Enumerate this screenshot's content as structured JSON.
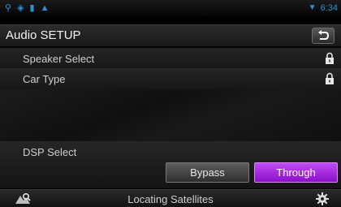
{
  "status_bar": {
    "icons": [
      "usb-icon",
      "wireless-icon",
      "battery-icon",
      "warning-icon"
    ],
    "clock": "6:34",
    "accent_color": "#2e8fd4"
  },
  "header": {
    "title": "Audio SETUP",
    "back_icon": "back-arrow-icon"
  },
  "settings": [
    {
      "label": "Speaker Select",
      "icon": "lock-icon"
    },
    {
      "label": "Car Type",
      "icon": "lock-icon"
    }
  ],
  "dsp": {
    "label": "DSP Select",
    "options": [
      "Bypass",
      "Through"
    ],
    "selected": "Through",
    "selected_color": "#a82ee0"
  },
  "footer": {
    "status": "Locating Satellites",
    "left_icon": "navigation-icon",
    "right_icon": "gear-icon"
  }
}
